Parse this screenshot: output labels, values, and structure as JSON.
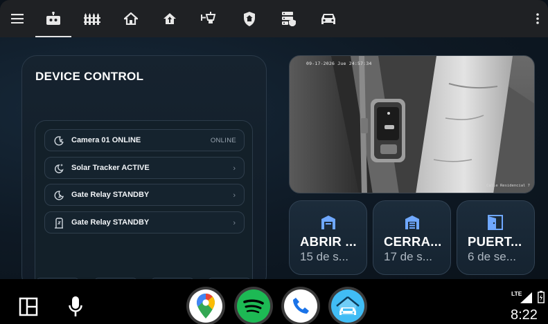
{
  "topbar": {
    "menu_icon": "hamburger-menu-icon",
    "tabs": [
      {
        "name": "robot-icon",
        "active": true
      },
      {
        "name": "fence-icon",
        "active": false
      },
      {
        "name": "home-icon",
        "active": false
      },
      {
        "name": "home-upload-icon",
        "active": false
      },
      {
        "name": "outdoor-light-icon",
        "active": false
      },
      {
        "name": "shield-home-icon",
        "active": false
      },
      {
        "name": "server-security-icon",
        "active": false
      },
      {
        "name": "car-icon",
        "active": false
      }
    ],
    "overflow_icon": "more-vertical-icon"
  },
  "device_control": {
    "title": "DEVICE CONTROL",
    "items": [
      {
        "label": "Camera 01 ONLINE",
        "status": "ONLINE",
        "icon": "sleep-moon-icon"
      },
      {
        "label": "Solar Tracker ACTIVE",
        "status": "",
        "icon": "night-sparkle-icon"
      },
      {
        "label": "Gate Relay STANDBY",
        "status": "",
        "icon": "moon-sleep-icon"
      },
      {
        "label": "Gate Relay STANDBY",
        "status": "",
        "icon": "door-sleep-icon"
      }
    ]
  },
  "camera": {
    "timestamp": "09-17-2026 Jue 24:57:34",
    "name": "Calle Residencial 7"
  },
  "tiles": [
    {
      "title": "ABRIR ...",
      "subtitle": "15 de s...",
      "icon": "garage-open-icon"
    },
    {
      "title": "CERRA...",
      "subtitle": "17 de s...",
      "icon": "garage-closed-icon"
    },
    {
      "title": "PUERT...",
      "subtitle": "6 de se...",
      "icon": "door-open-icon"
    }
  ],
  "dock": {
    "layout_icon": "layout-grid-icon",
    "mic_icon": "microphone-icon",
    "apps": [
      "maps-app-icon",
      "spotify-app-icon",
      "phone-app-icon",
      "home-assistant-car-icon"
    ],
    "network": "LTE",
    "clock": "8:22"
  },
  "colors": {
    "accent": "#6fa8ff",
    "topbar_bg": "#1f2124",
    "card_bg": "#16232f",
    "dock_bg": "#000000"
  }
}
